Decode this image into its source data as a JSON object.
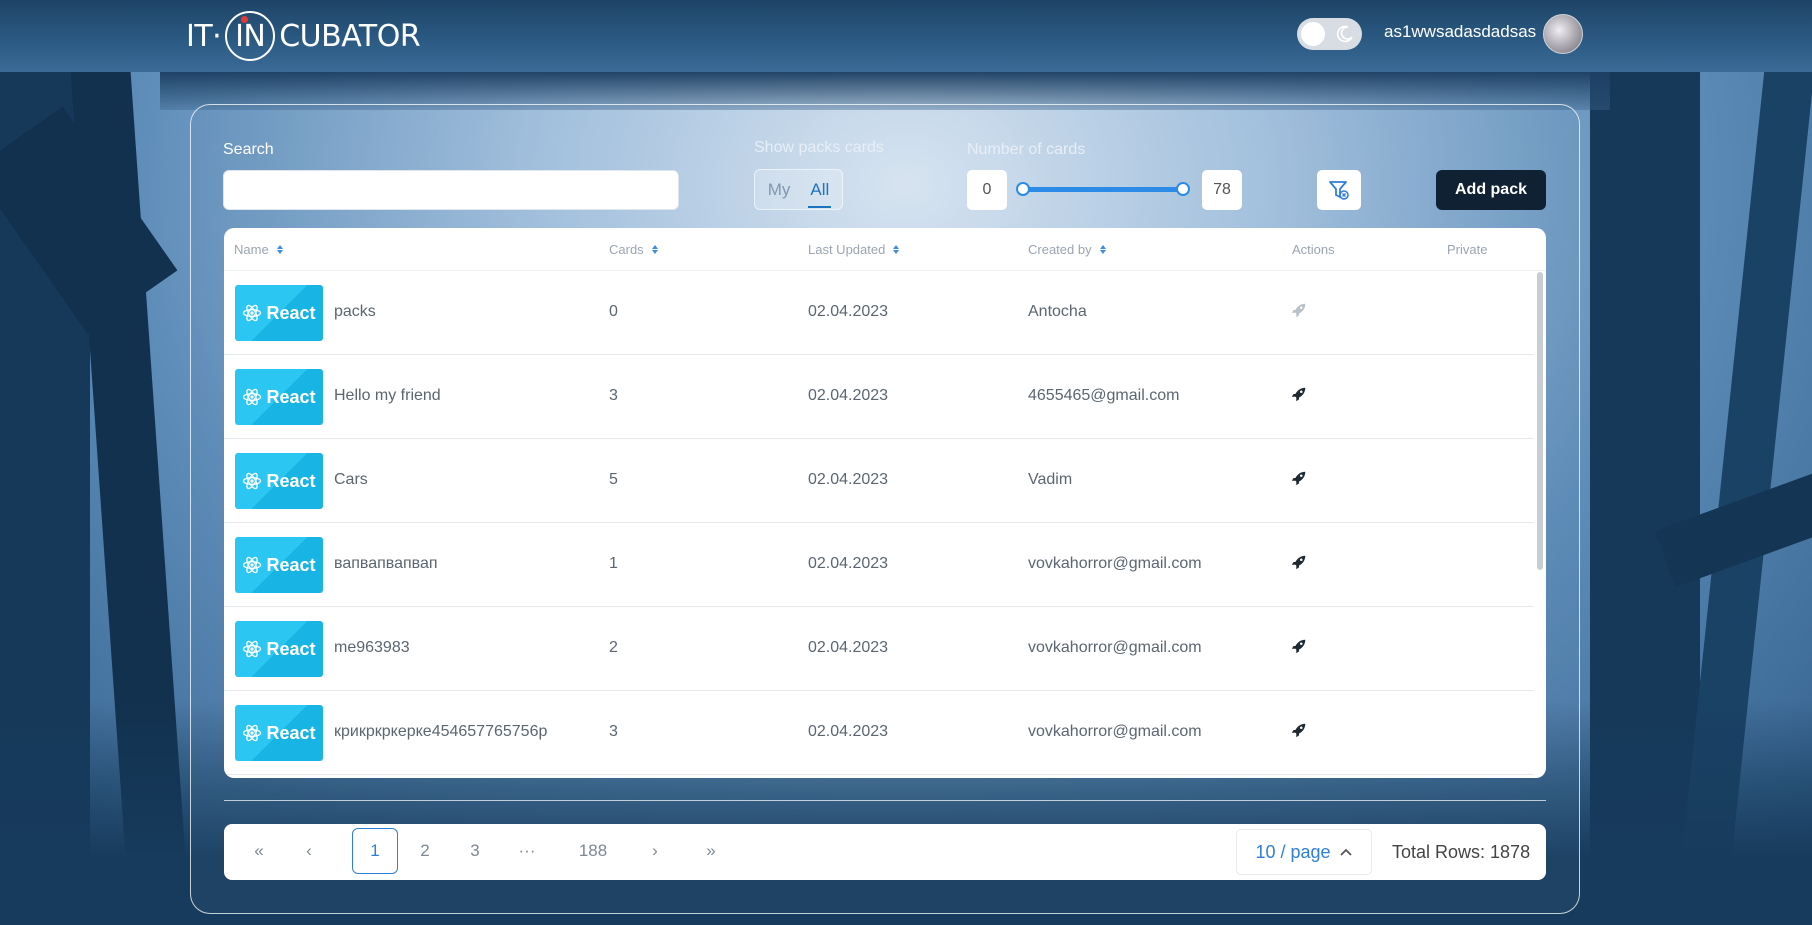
{
  "header": {
    "logo_left": "IT·",
    "logo_circle": "IN",
    "logo_right": "CUBATOR",
    "username": "as1wwsadasdadsas"
  },
  "filters": {
    "search_label": "Search",
    "search_placeholder": "",
    "show_label": "Show packs cards",
    "show_options": [
      "My",
      "All"
    ],
    "show_selected": "All",
    "number_label": "Number of cards",
    "min_value": "0",
    "max_value": "78",
    "add_pack_label": "Add pack"
  },
  "table": {
    "columns": [
      "Name",
      "Cards",
      "Last Updated",
      "Created by",
      "Actions",
      "Private"
    ],
    "image_text": "React",
    "rows": [
      {
        "name": "packs",
        "cards": "0",
        "updated": "02.04.2023",
        "created_by": "Antocha"
      },
      {
        "name": "Hello my friend",
        "cards": "3",
        "updated": "02.04.2023",
        "created_by": "4655465@gmail.com"
      },
      {
        "name": "Cars",
        "cards": "5",
        "updated": "02.04.2023",
        "created_by": "Vadim"
      },
      {
        "name": "вапвапвапвап",
        "cards": "1",
        "updated": "02.04.2023",
        "created_by": "vovkahorror@gmail.com"
      },
      {
        "name": "me963983",
        "cards": "2",
        "updated": "02.04.2023",
        "created_by": "vovkahorror@gmail.com"
      },
      {
        "name": "крикркркерке454657765756р",
        "cards": "3",
        "updated": "02.04.2023",
        "created_by": "vovkahorror@gmail.com"
      }
    ]
  },
  "pagination": {
    "first": "«",
    "prev": "‹",
    "pages": [
      "1",
      "2",
      "3"
    ],
    "ellipsis": "···",
    "last_page": "188",
    "next": "›",
    "last": "»",
    "active_page": "1",
    "page_size": "10 / page",
    "total_rows": "Total Rows: 1878"
  },
  "colors": {
    "accent": "#2f7fd8",
    "header_bg": "#2c5b85",
    "add_button": "#0f2133",
    "react_tile": "#2cc6f2"
  },
  "icons": {
    "action": "rocket-icon",
    "filter": "filter-reset-icon",
    "theme": "moon-icon",
    "sort": "sort-arrows-icon"
  }
}
